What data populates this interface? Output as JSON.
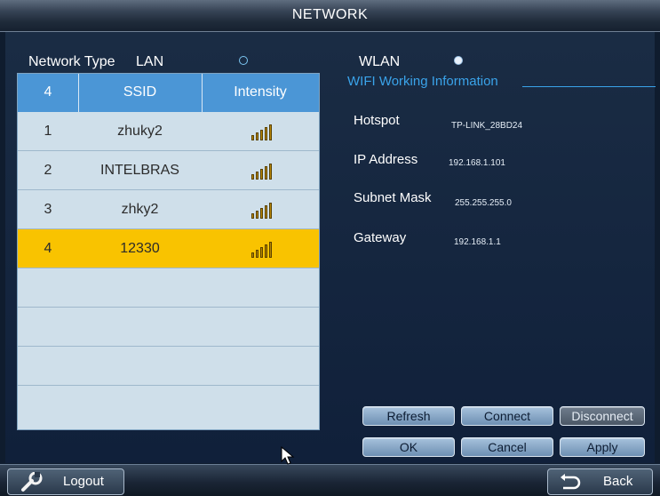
{
  "window": {
    "title": "NETWORK"
  },
  "network_type": {
    "label": "Network Type",
    "lan_label": "LAN",
    "lan_selected": false,
    "wlan_label": "WLAN",
    "wlan_selected": true
  },
  "wifi_table": {
    "header": {
      "count": "4",
      "ssid": "SSID",
      "intensity": "Intensity"
    },
    "rows": [
      {
        "no": "1",
        "ssid": "zhuky2",
        "signal_icon": "signal-strength-icon",
        "selected": false
      },
      {
        "no": "2",
        "ssid": "INTELBRAS",
        "signal_icon": "signal-strength-icon",
        "selected": false
      },
      {
        "no": "3",
        "ssid": "zhky2",
        "signal_icon": "signal-strength-icon",
        "selected": false
      },
      {
        "no": "4",
        "ssid": "12330",
        "signal_icon": "signal-strength-icon",
        "selected": true
      }
    ]
  },
  "wifi_info": {
    "title": "WIFI Working Information",
    "hotspot_label": "Hotspot",
    "hotspot_value": "TP-LINK_28BD24",
    "ip_label": "IP Address",
    "ip_value": "192.168.1.101",
    "mask_label": "Subnet Mask",
    "mask_value": "255.255.255.0",
    "gateway_label": "Gateway",
    "gateway_value": "192.168.1.1"
  },
  "buttons": {
    "refresh": "Refresh",
    "connect": "Connect",
    "disconnect": "Disconnect",
    "ok": "OK",
    "cancel": "Cancel",
    "apply": "Apply"
  },
  "bottom": {
    "logout_label": "Logout",
    "logout_icon": "wrench-icon",
    "back_label": "Back",
    "back_icon": "return-arrow-icon"
  },
  "colors": {
    "accent_blue": "#4b96d6",
    "selected_row": "#f9c300",
    "info_title": "#3aa3ea"
  }
}
